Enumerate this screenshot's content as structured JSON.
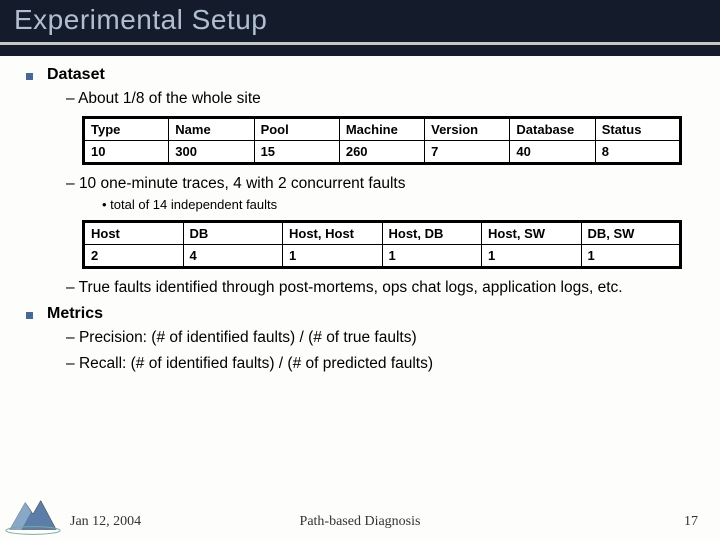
{
  "title": "Experimental Setup",
  "sections": {
    "dataset": {
      "heading": "Dataset",
      "sub1": "About 1/8 of the whole site",
      "table1": {
        "headers": [
          "Type",
          "Name",
          "Pool",
          "Machine",
          "Version",
          "Database",
          "Status"
        ],
        "row": [
          "10",
          "300",
          "15",
          "260",
          "7",
          "40",
          "8"
        ]
      },
      "sub2": "10 one-minute traces, 4 with 2 concurrent faults",
      "sub2a": "total of 14 independent faults",
      "table2": {
        "headers": [
          "Host",
          "DB",
          "Host, Host",
          "Host, DB",
          "Host, SW",
          "DB, SW"
        ],
        "row": [
          "2",
          "4",
          "1",
          "1",
          "1",
          "1"
        ]
      },
      "sub3": "True faults identified through post-mortems, ops chat logs, application logs, etc."
    },
    "metrics": {
      "heading": "Metrics",
      "precision": "Precision: (# of identified faults) / (# of true faults)",
      "recall": "Recall: (# of identified faults) / (# of predicted faults)"
    }
  },
  "footer": {
    "date": "Jan 12, 2004",
    "center": "Path-based Diagnosis",
    "page": "17"
  }
}
